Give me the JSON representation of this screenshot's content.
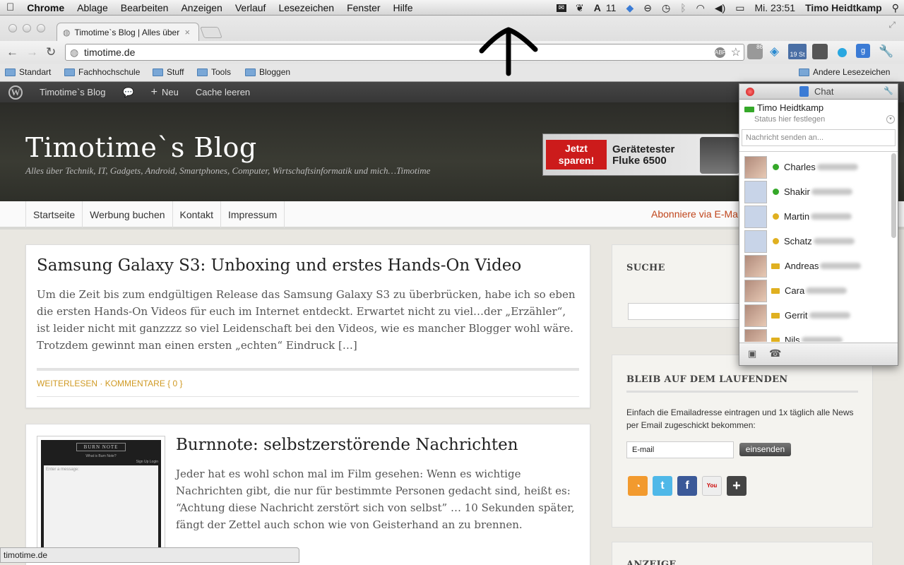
{
  "menubar": {
    "app": "Chrome",
    "items": [
      "Ablage",
      "Bearbeiten",
      "Anzeigen",
      "Verlauf",
      "Lesezeichen",
      "Fenster",
      "Hilfe"
    ],
    "badge": "11",
    "clock": "Mi. 23:51",
    "user": "Timo Heidtkamp"
  },
  "browser": {
    "tab_title": "Timotime`s Blog | Alles über",
    "url": "timotime.de",
    "bookmarks": [
      "Standart",
      "Fachhochschule",
      "Stuff",
      "Tools",
      "Bloggen"
    ],
    "other_bookmarks": "Andere Lesezeichen",
    "ext_badges": [
      "86",
      "19 St"
    ]
  },
  "wpbar": {
    "blog": "Timotime`s Blog",
    "new": "Neu",
    "cache": "Cache leeren"
  },
  "site": {
    "title": "Timotime`s Blog",
    "tagline": "Alles über Technik, IT, Gadgets, Android, Smartphones, Computer, Wirtschaftsinformatik und mich…Timotime",
    "ad": {
      "cta": "Jetzt sparen!",
      "text": "Gerätetester Fluke 6500"
    },
    "nav": [
      "Startseite",
      "Werbung buchen",
      "Kontakt",
      "Impressum"
    ],
    "subscribe": "Abonniere via E-Ma"
  },
  "posts": [
    {
      "title": "Samsung Galaxy S3: Unboxing und erstes Hands-On Video",
      "excerpt": "Um die Zeit bis zum endgültigen Release das Samsung Galaxy S3 zu überbrücken, habe ich so eben die ersten Hands-On Videos für euch im Internet entdeckt. Erwartet nicht zu viel…der „Erzähler“, ist leider nicht mit ganzzzz so viel Leidenschaft bei den Videos, wie es mancher Blogger wohl wäre. Trotzdem gewinnt man einen ersten „echten“ Eindruck […]",
      "more": "WEITERLESEN",
      "sep": "·",
      "comments": "KOMMENTARE { 0 }"
    },
    {
      "title": "Burnnote: selbstzerstörende Nachrichten",
      "excerpt": "Jeder hat es wohl schon mal im Film gesehen: Wenn es wichtige Nachrichten gibt, die nur für bestimmte Personen gedacht sind, heißt es: “Achtung diese Nachricht zerstört sich von selbst” … 10 Sekunden später, fängt der Zettel auch schon wie von Geisterhand an zu brennen.",
      "thumb": {
        "title": "BURN NOTE",
        "link": "What is Burn Note?",
        "menu": "Sign Up  Login",
        "placeholder": "Enter a message:"
      }
    }
  ],
  "sidebar": {
    "search_title": "SUCHE",
    "subscribe_title": "BLEIB AUF DEM LAUFENDEN",
    "subscribe_text": "Einfach die Emailadresse eintragen und 1x täglich alle News per Email zugeschickt bekommen:",
    "email_placeholder": "E-mail",
    "submit": "einsenden",
    "third_title": "ANZEIGE",
    "social": [
      "rss-icon",
      "twitter-icon",
      "facebook-icon",
      "youtube-icon",
      "google-plus-icon"
    ]
  },
  "chat": {
    "title": "Chat",
    "me": "Timo Heidtkamp",
    "status_placeholder": "Status hier festlegen",
    "send_placeholder": "Nachricht senden an...",
    "contacts": [
      {
        "name": "Charles",
        "status": "#35a829",
        "photo": true
      },
      {
        "name": "Shakir",
        "status": "#35a829",
        "photo": false
      },
      {
        "name": "Martin",
        "status": "#e0b020",
        "photo": false
      },
      {
        "name": "Schatz",
        "status": "#e0b020",
        "photo": false
      },
      {
        "name": "Andreas",
        "status": "video",
        "photo": true
      },
      {
        "name": "Cara",
        "status": "video",
        "photo": true
      },
      {
        "name": "Gerrit",
        "status": "video",
        "photo": true
      },
      {
        "name": "Nils",
        "status": "video",
        "photo": true
      }
    ]
  },
  "statusbar": "timotime.de",
  "colors": {
    "accent_link": "#d09a24",
    "subscribe": "#c0451b",
    "header_bg": "#33342e"
  }
}
